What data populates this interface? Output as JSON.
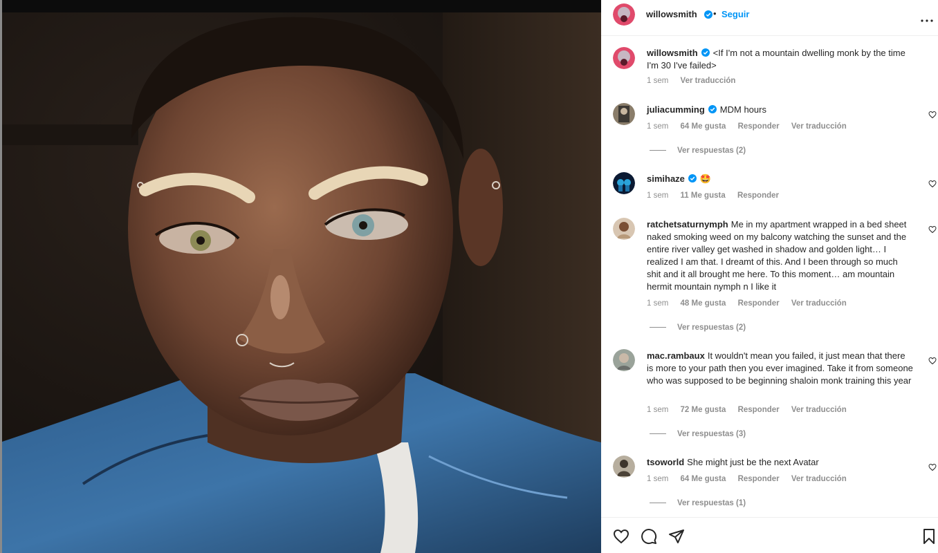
{
  "post": {
    "author": "willowsmith",
    "dot": "•",
    "follow_label": "Seguir",
    "caption": "<If I'm not a mountain dwelling monk by the time I'm 30 I've failed>",
    "caption_time": "1 sem",
    "caption_translate": "Ver traducción"
  },
  "comments": [
    {
      "user": "juliacumming",
      "verified": true,
      "text": "MDM hours",
      "time": "1 sem",
      "likes": "64 Me gusta",
      "reply": "Responder",
      "translate": "Ver traducción",
      "replies": "Ver respuestas (2)"
    },
    {
      "user": "simihaze",
      "verified": true,
      "text": "🤩",
      "time": "1 sem",
      "likes": "11 Me gusta",
      "reply": "Responder",
      "translate": "",
      "replies": ""
    },
    {
      "user": "ratchetsaturnymph",
      "verified": false,
      "text": "Me in my apartment wrapped in a bed sheet naked smoking weed on my balcony watching the sunset and the entire river valley get washed in shadow and golden light… I realized I am that. I dreamt of this. And I been through so much shit and it all brought me here. To this moment… am mountain hermit mountain nymph n I like it",
      "time": "1 sem",
      "likes": "48 Me gusta",
      "reply": "Responder",
      "translate": "Ver traducción",
      "replies": "Ver respuestas (2)"
    },
    {
      "user": "mac.rambaux",
      "verified": false,
      "text": "It wouldn't mean you failed, it just mean that there is more to your path then you ever imagined. Take it from someone who was supposed to be beginning shaloin monk training this year",
      "time": "1 sem",
      "likes": "72 Me gusta",
      "reply": "Responder",
      "translate": "Ver traducción",
      "replies": "Ver respuestas (3)"
    },
    {
      "user": "tsoworld",
      "verified": false,
      "text": "She might just be the next Avatar",
      "time": "1 sem",
      "likes": "64 Me gusta",
      "reply": "Responder",
      "translate": "Ver traducción",
      "replies": "Ver respuestas (1)"
    }
  ],
  "icons": {
    "verified": "verified-badge-icon",
    "more": "more-options-icon",
    "like": "heart-icon",
    "comment": "comment-icon",
    "share": "share-icon",
    "save": "bookmark-icon"
  },
  "colors": {
    "accent": "#0095f6",
    "verified": "#0095f6",
    "muted": "#8e8e8e",
    "text": "#262626"
  }
}
